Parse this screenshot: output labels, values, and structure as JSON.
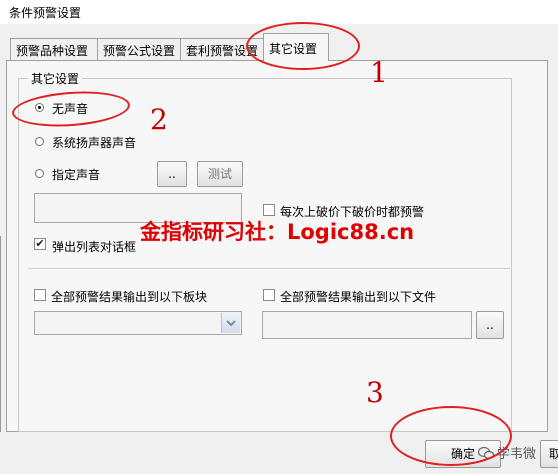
{
  "window": {
    "title": "条件预警设置"
  },
  "tabs": [
    {
      "label": "预警品种设置"
    },
    {
      "label": "预警公式设置"
    },
    {
      "label": "套利预警设置"
    },
    {
      "label": "其它设置"
    }
  ],
  "active_tab": "其它设置",
  "group": {
    "label": "其它设置"
  },
  "sound": {
    "options": [
      {
        "label": "无声音",
        "selected": true
      },
      {
        "label": "系统扬声器声音",
        "selected": false
      },
      {
        "label": "指定声音",
        "selected": false
      }
    ],
    "browse_label": "..",
    "test_label": "测试",
    "file_value": ""
  },
  "checks": {
    "break_alert": {
      "label": "每次上破价下破价时都预警",
      "checked": false
    },
    "popup_dialog": {
      "label": "弹出列表对话框",
      "checked": true
    },
    "output_block": {
      "label": "全部预警结果输出到以下板块",
      "checked": false
    },
    "output_file": {
      "label": "全部预警结果输出到以下文件",
      "checked": false
    }
  },
  "file_output": {
    "browse_label": "..",
    "value": ""
  },
  "block_select": {
    "value": ""
  },
  "footer": {
    "ok_label": "确定",
    "next_partial": "取"
  },
  "watermark": {
    "text": "金指标研习社：Logic88.cn",
    "credit": "学韦微"
  },
  "annotations": [
    "1",
    "2",
    "3"
  ],
  "colors": {
    "annotation": "#e02020",
    "watermark": "#e00000",
    "panel": "#f7f7f7"
  }
}
